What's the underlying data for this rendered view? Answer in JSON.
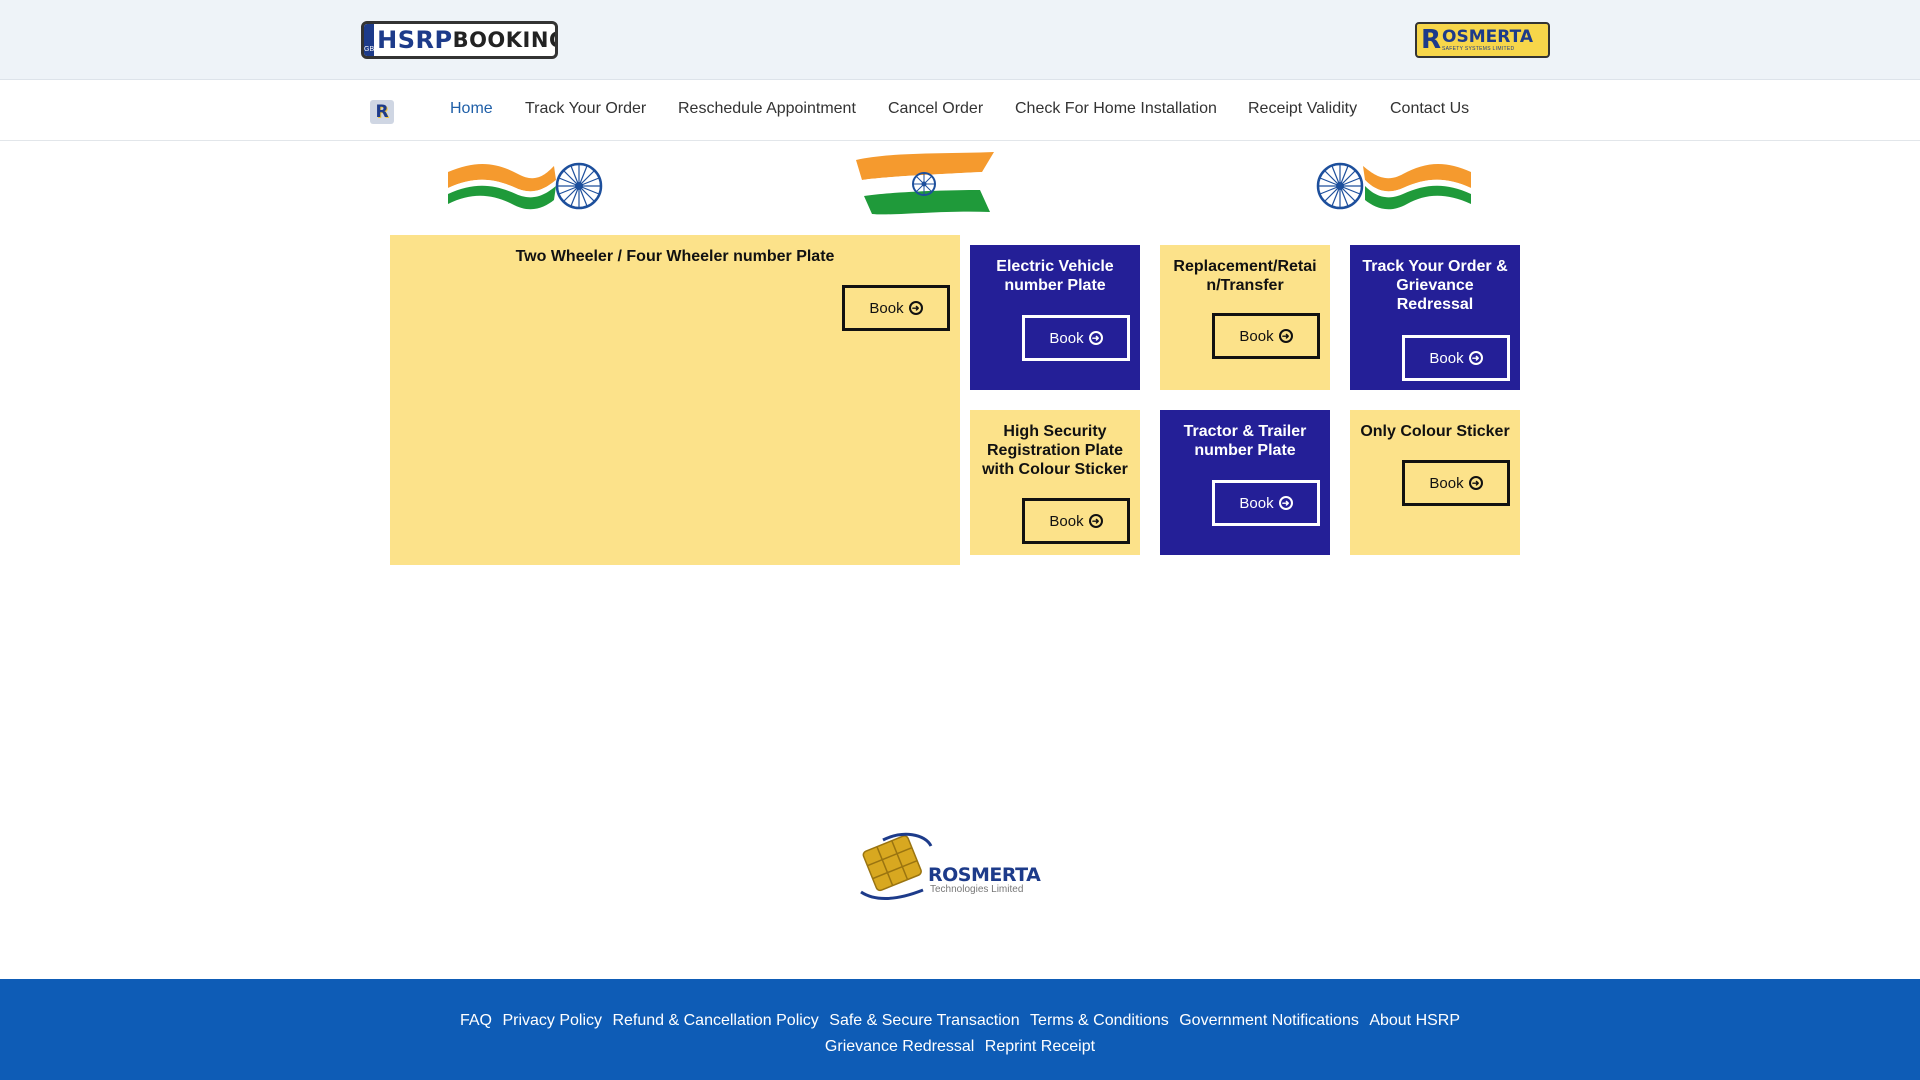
{
  "header": {
    "hsrp_logo": {
      "badge": "GB",
      "part1": "HSRP",
      "part2": "BOOKING"
    },
    "rosmerta_logo": {
      "letter": "R",
      "name": "OSMERTA",
      "subtitle": "SAFETY SYSTEMS LIMITED"
    }
  },
  "nav": {
    "badge": "R",
    "items": [
      {
        "label": "Home",
        "active": true
      },
      {
        "label": "Track Your Order"
      },
      {
        "label": "Reschedule Appointment"
      },
      {
        "label": "Cancel Order"
      },
      {
        "label": "Check For Home Installation"
      },
      {
        "label": "Receipt Validity"
      },
      {
        "label": "Contact Us"
      }
    ]
  },
  "cards": {
    "two_four_wheeler": {
      "title": "Two Wheeler / Four Wheeler number Plate",
      "button": "Book"
    },
    "electric_vehicle": {
      "title": "Electric Vehicle number Plate",
      "button": "Book"
    },
    "replacement": {
      "title": "Replacement/Retai n/Transfer",
      "button": "Book"
    },
    "track_order": {
      "title": "Track Your Order & Grievance Redressal",
      "button": "Book"
    },
    "hsrp_sticker": {
      "title": "High Security Registration Plate with Colour Sticker",
      "button": "Book"
    },
    "tractor": {
      "title": "Tractor & Trailer number Plate",
      "button": "Book"
    },
    "colour_sticker": {
      "title": "Only Colour Sticker",
      "button": "Book"
    }
  },
  "tech_logo": {
    "name": "ROSMERTA",
    "subtitle": "Technologies Limited"
  },
  "footer": {
    "links": [
      "FAQ",
      "Privacy Policy",
      "Refund & Cancellation Policy",
      "Safe & Secure Transaction",
      "Terms & Conditions",
      "Government Notifications",
      "About HSRP",
      "Grievance Redressal",
      "Reprint Receipt"
    ]
  },
  "colors": {
    "card_yellow": "#fce28a",
    "card_blue": "#241f97",
    "footer_blue": "#0e5cb6",
    "nav_active": "#1f5fa8",
    "saffron": "#f59a2e",
    "green": "#1f9a3a",
    "chakra": "#1d4f9c"
  }
}
